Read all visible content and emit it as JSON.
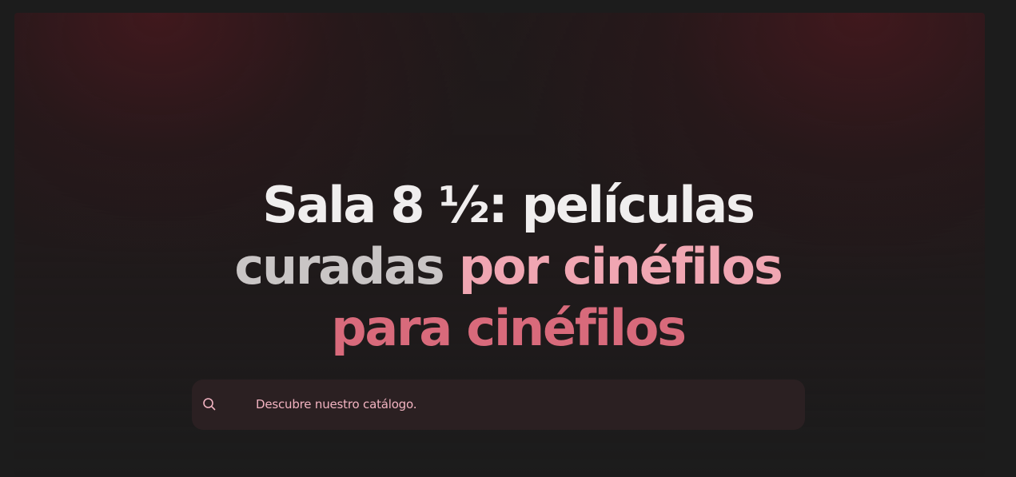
{
  "hero": {
    "title_line1": "Sala 8 ½: películas",
    "title_line2_a": "curadas",
    "title_line2_b": "por cinéfilos",
    "title_line3": "para cinéfilos"
  },
  "search": {
    "icon": "search-icon",
    "placeholder": "Descubre nuestro catálogo."
  },
  "colors": {
    "background": "#1c1c1c",
    "accent_pink": "#f0a6b2",
    "accent_red": "#b73246",
    "search_text": "#f2b3c1"
  }
}
